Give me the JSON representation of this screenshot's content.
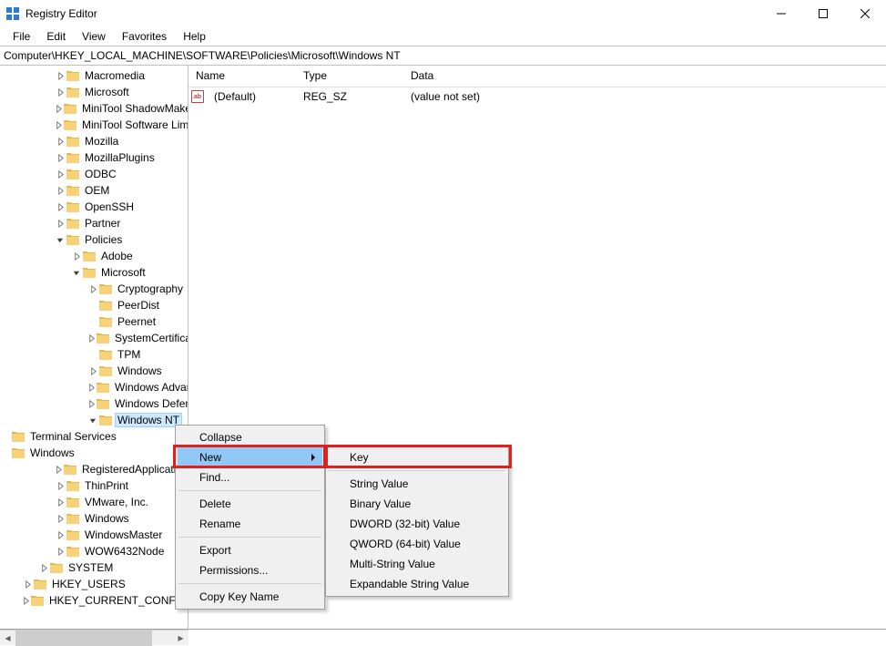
{
  "titlebar": {
    "title": "Registry Editor"
  },
  "menubar": [
    "File",
    "Edit",
    "View",
    "Favorites",
    "Help"
  ],
  "address": "Computer\\HKEY_LOCAL_MACHINE\\SOFTWARE\\Policies\\Microsoft\\Windows NT",
  "columns": {
    "name": "Name",
    "type": "Type",
    "data": "Data"
  },
  "values": [
    {
      "name": "(Default)",
      "type": "REG_SZ",
      "data": "(value not set)"
    }
  ],
  "tree": [
    {
      "level": 2,
      "exp": "closed",
      "label": "Macromedia"
    },
    {
      "level": 2,
      "exp": "closed",
      "label": "Microsoft"
    },
    {
      "level": 2,
      "exp": "closed",
      "label": "MiniTool ShadowMaker"
    },
    {
      "level": 2,
      "exp": "closed",
      "label": "MiniTool Software Limited"
    },
    {
      "level": 2,
      "exp": "closed",
      "label": "Mozilla"
    },
    {
      "level": 2,
      "exp": "closed",
      "label": "MozillaPlugins"
    },
    {
      "level": 2,
      "exp": "closed",
      "label": "ODBC"
    },
    {
      "level": 2,
      "exp": "closed",
      "label": "OEM"
    },
    {
      "level": 2,
      "exp": "closed",
      "label": "OpenSSH"
    },
    {
      "level": 2,
      "exp": "closed",
      "label": "Partner"
    },
    {
      "level": 2,
      "exp": "open",
      "label": "Policies"
    },
    {
      "level": 3,
      "exp": "closed",
      "label": "Adobe"
    },
    {
      "level": 3,
      "exp": "open",
      "label": "Microsoft"
    },
    {
      "level": 4,
      "exp": "closed",
      "label": "Cryptography"
    },
    {
      "level": 4,
      "exp": "none",
      "label": "PeerDist"
    },
    {
      "level": 4,
      "exp": "none",
      "label": "Peernet"
    },
    {
      "level": 4,
      "exp": "closed",
      "label": "SystemCertificates"
    },
    {
      "level": 4,
      "exp": "none",
      "label": "TPM"
    },
    {
      "level": 4,
      "exp": "closed",
      "label": "Windows"
    },
    {
      "level": 4,
      "exp": "closed",
      "label": "Windows Advanced Threat Protection"
    },
    {
      "level": 4,
      "exp": "closed",
      "label": "Windows Defender"
    },
    {
      "level": 4,
      "exp": "open",
      "label": "Windows NT",
      "selected": true
    },
    {
      "level": 5,
      "exp": "none",
      "label": "Terminal Services"
    },
    {
      "level": 5,
      "exp": "none",
      "label": "Windows"
    },
    {
      "level": 2,
      "exp": "closed",
      "label": "RegisteredApplications"
    },
    {
      "level": 2,
      "exp": "closed",
      "label": "ThinPrint"
    },
    {
      "level": 2,
      "exp": "closed",
      "label": "VMware, Inc."
    },
    {
      "level": 2,
      "exp": "closed",
      "label": "Windows"
    },
    {
      "level": 2,
      "exp": "closed",
      "label": "WindowsMaster"
    },
    {
      "level": 2,
      "exp": "closed",
      "label": "WOW6432Node"
    },
    {
      "level": 1,
      "exp": "closed",
      "label": "SYSTEM"
    },
    {
      "level": 0,
      "exp": "closed",
      "label": "HKEY_USERS"
    },
    {
      "level": 0,
      "exp": "closed",
      "label": "HKEY_CURRENT_CONFIG"
    }
  ],
  "context_menu_1": {
    "items": [
      {
        "label": "Collapse"
      },
      {
        "label": "New",
        "submenu": true,
        "hover": true
      },
      {
        "label": "Find..."
      },
      {
        "sep": true
      },
      {
        "label": "Delete"
      },
      {
        "label": "Rename"
      },
      {
        "sep": true
      },
      {
        "label": "Export"
      },
      {
        "label": "Permissions..."
      },
      {
        "sep": true
      },
      {
        "label": "Copy Key Name"
      }
    ]
  },
  "context_menu_2": {
    "items": [
      {
        "label": "Key"
      },
      {
        "sep": true
      },
      {
        "label": "String Value"
      },
      {
        "label": "Binary Value"
      },
      {
        "label": "DWORD (32-bit) Value"
      },
      {
        "label": "QWORD (64-bit) Value"
      },
      {
        "label": "Multi-String Value"
      },
      {
        "label": "Expandable String Value"
      }
    ]
  }
}
